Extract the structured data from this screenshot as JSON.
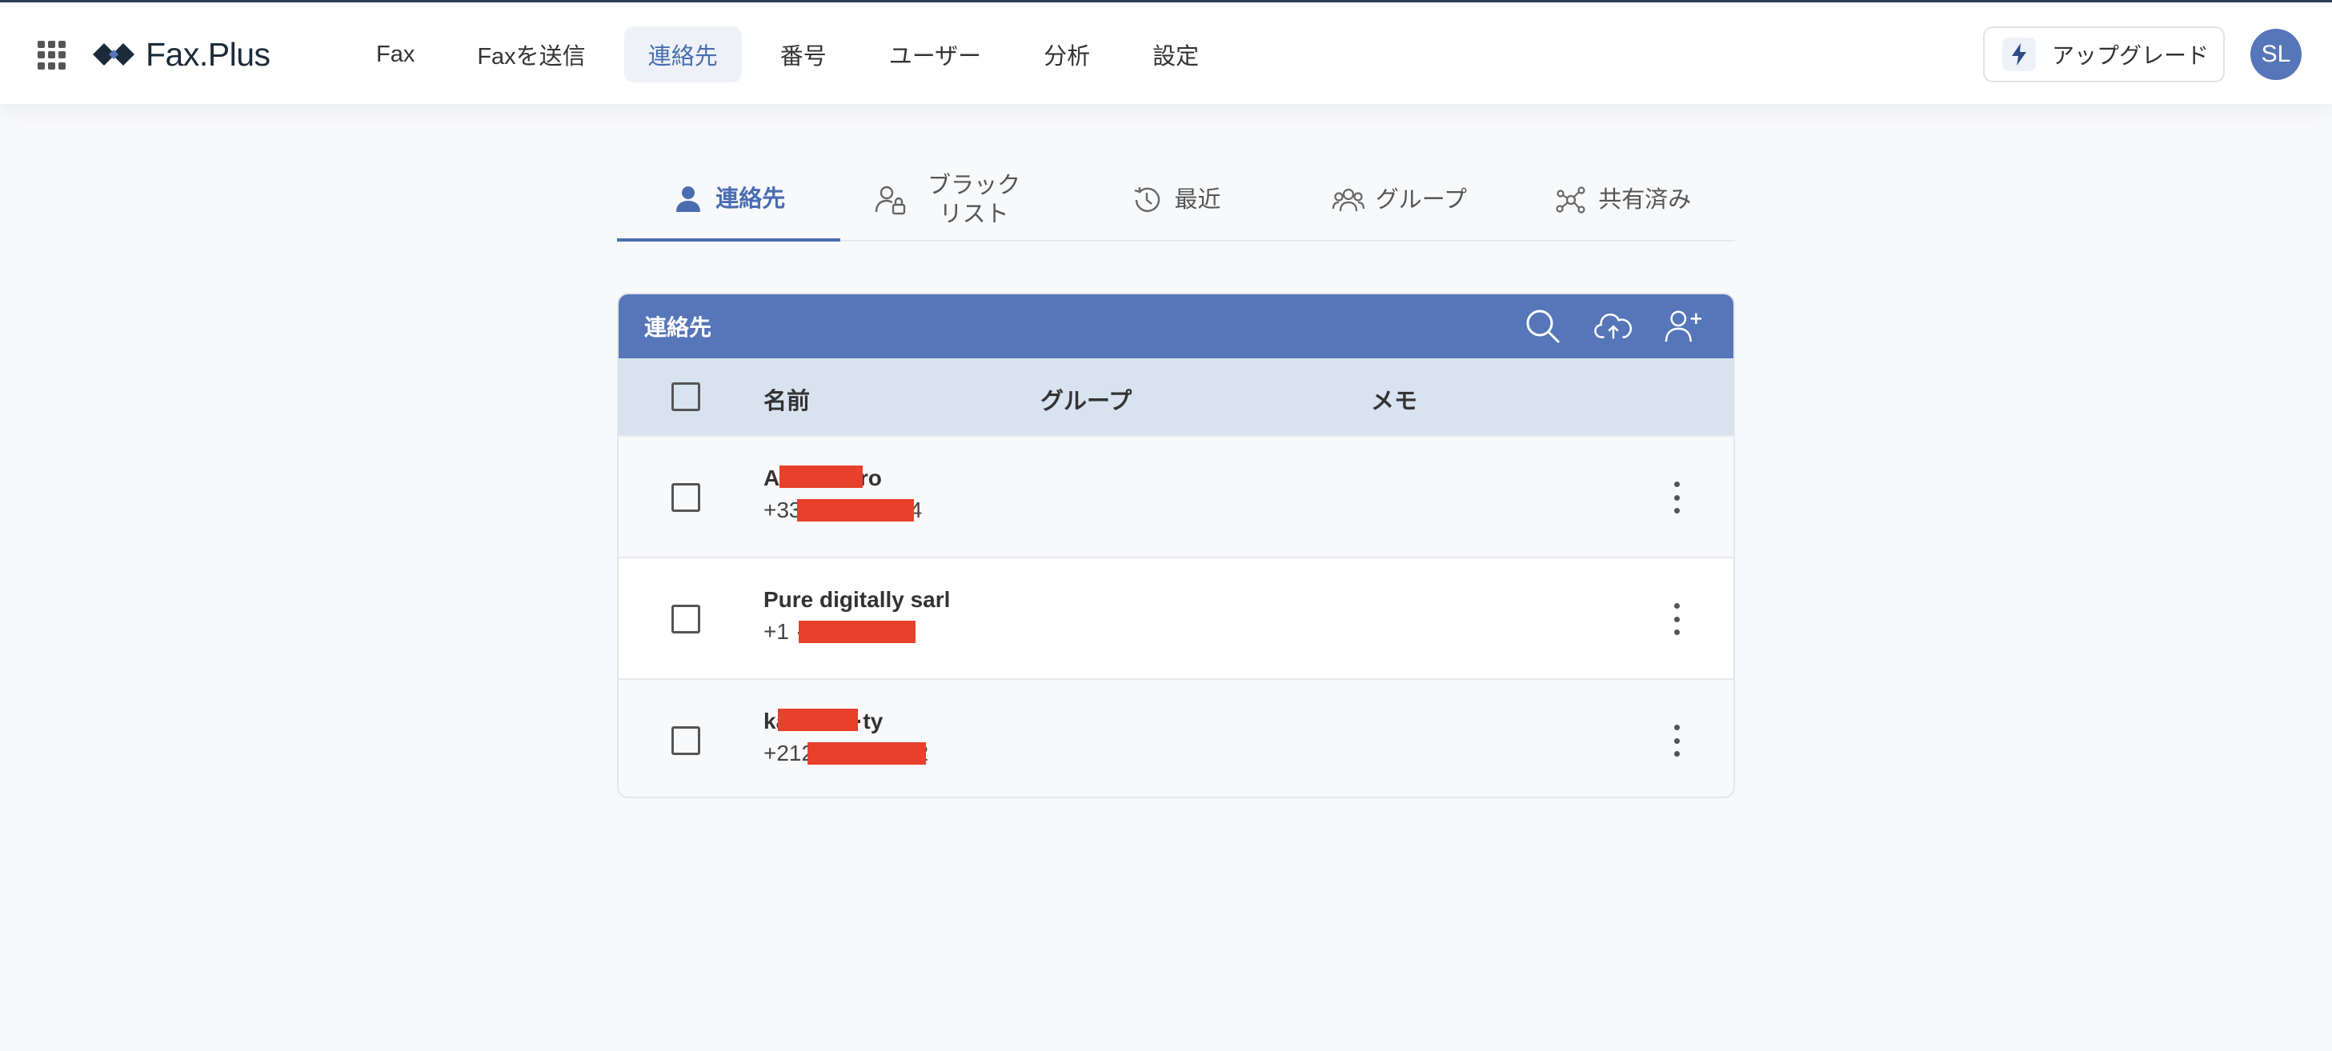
{
  "header": {
    "apps_icon": "grid-icon",
    "brand": "Fax.Plus",
    "nav": [
      "Fax",
      "Faxを送信",
      "連絡先",
      "番号",
      "ユーザー",
      "分析",
      "設定"
    ],
    "active_nav": "連絡先",
    "upgrade_label": "アップグレード",
    "avatar_initials": "SL"
  },
  "tabs": [
    {
      "label": "連絡先",
      "icon": "person-icon",
      "active": true
    },
    {
      "label": "ブラックリスト",
      "icon": "person-lock-icon",
      "active": false
    },
    {
      "label": "最近",
      "icon": "history-icon",
      "active": false
    },
    {
      "label": "グループ",
      "icon": "group-icon",
      "active": false
    },
    {
      "label": "共有済み",
      "icon": "share-icon",
      "active": false
    }
  ],
  "card": {
    "title": "連絡先",
    "actions": [
      "search-icon",
      "cloud-upload-icon",
      "add-contact-icon"
    ],
    "columns": {
      "name": "名前",
      "group": "グループ",
      "memo": "メモ"
    },
    "rows": [
      {
        "name": "Adam Pero",
        "phone": "+33 ············34"
      },
      {
        "name": "Pure digitally sarl",
        "phone": "+1 ············49"
      },
      {
        "name": "ka··········ty",
        "phone": "+212············72"
      }
    ]
  },
  "colors": {
    "accent": "#5676b9",
    "header_row": "#d8e3ef",
    "redaction": "#e8402a"
  }
}
